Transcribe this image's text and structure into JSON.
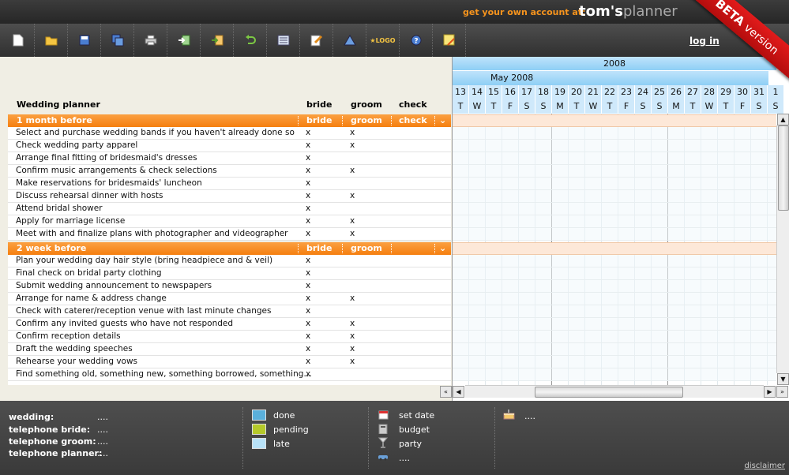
{
  "header": {
    "promo": "get your own account at:",
    "brand_t": "tom's",
    "brand_p": "planner",
    "ribbon_beta": "BETA",
    "ribbon_version": "version",
    "login": "log in"
  },
  "toolbar": {
    "buttons": [
      "new",
      "open",
      "save",
      "save-as",
      "print",
      "import",
      "export",
      "undo",
      "view",
      "edit",
      "zoom",
      "logo",
      "help",
      "add-note"
    ],
    "logo_label": "★LOGO"
  },
  "table": {
    "title": "Wedding planner",
    "col_bride": "bride",
    "col_groom": "groom",
    "col_check": "check",
    "groups": [
      {
        "name": "1 month before",
        "bride": "bride",
        "groom": "groom",
        "check": "check",
        "rows": [
          {
            "task": "Select and purchase wedding bands if you haven't already done so",
            "bride": "x",
            "groom": "x"
          },
          {
            "task": "Check wedding party apparel",
            "bride": "x",
            "groom": "x"
          },
          {
            "task": "Arrange final fitting of bridesmaid's dresses",
            "bride": "x",
            "groom": ""
          },
          {
            "task": "Confirm music arrangements & check selections",
            "bride": "x",
            "groom": "x"
          },
          {
            "task": "Make reservations for bridesmaids' luncheon",
            "bride": "x",
            "groom": ""
          },
          {
            "task": "Discuss rehearsal dinner with hosts",
            "bride": "x",
            "groom": "x"
          },
          {
            "task": "Attend bridal shower",
            "bride": "x",
            "groom": ""
          },
          {
            "task": "Apply for marriage license",
            "bride": "x",
            "groom": "x"
          },
          {
            "task": "Meet with and finalize plans with photographer and videographer",
            "bride": "x",
            "groom": "x"
          }
        ]
      },
      {
        "name": "2 week before",
        "bride": "bride",
        "groom": "groom",
        "check": "",
        "rows": [
          {
            "task": "Plan your wedding day hair style (bring headpiece and & veil)",
            "bride": "x",
            "groom": ""
          },
          {
            "task": "Final check on bridal party clothing",
            "bride": "x",
            "groom": ""
          },
          {
            "task": "Submit wedding announcement to newspapers",
            "bride": "x",
            "groom": ""
          },
          {
            "task": "Arrange for name & address change",
            "bride": "x",
            "groom": "x"
          },
          {
            "task": "Check with caterer/reception venue with last minute changes",
            "bride": "x",
            "groom": ""
          },
          {
            "task": "Confirm any invited guests who have not responded",
            "bride": "x",
            "groom": "x"
          },
          {
            "task": "Confirm reception details",
            "bride": "x",
            "groom": "x"
          },
          {
            "task": "Draft the wedding speeches",
            "bride": "x",
            "groom": "x"
          },
          {
            "task": "Rehearse your wedding vows",
            "bride": "x",
            "groom": "x"
          },
          {
            "task": "Find something old, something new, something borrowed, something…",
            "bride": "x",
            "groom": ""
          }
        ]
      }
    ]
  },
  "gantt": {
    "year": "2008",
    "month": "May 2008",
    "days": [
      "13",
      "14",
      "15",
      "16",
      "17",
      "18",
      "19",
      "20",
      "21",
      "22",
      "23",
      "24",
      "25",
      "26",
      "27",
      "28",
      "29",
      "30",
      "31",
      "1"
    ],
    "weekdays": [
      "T",
      "W",
      "T",
      "F",
      "S",
      "S",
      "M",
      "T",
      "W",
      "T",
      "F",
      "S",
      "S",
      "M",
      "T",
      "W",
      "T",
      "F",
      "S",
      "S"
    ]
  },
  "footer": {
    "fields": [
      {
        "label": "wedding:",
        "value": "...."
      },
      {
        "label": "telephone bride:",
        "value": "...."
      },
      {
        "label": "telephone groom:",
        "value": "...."
      },
      {
        "label": "telephone planner:",
        "value": "...."
      }
    ],
    "legend": [
      {
        "label": "done",
        "color": "#5ab0dc"
      },
      {
        "label": "pending",
        "color": "#b5c92a"
      },
      {
        "label": "late",
        "color": "#b8e2f8"
      }
    ],
    "icons": [
      {
        "icon": "calendar-icon",
        "label": "set date"
      },
      {
        "icon": "calculator-icon",
        "label": "budget"
      },
      {
        "icon": "glass-icon",
        "label": "party"
      },
      {
        "icon": "car-icon",
        "label": "...."
      }
    ],
    "cake_label": "....",
    "disclaimer": "disclaimer"
  }
}
